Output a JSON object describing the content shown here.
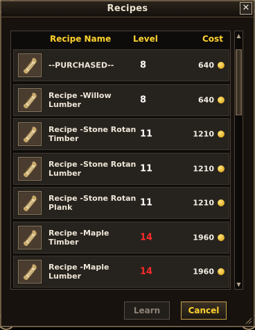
{
  "window": {
    "title": "Recipes",
    "close_glyph": "✕"
  },
  "header": {
    "name": "Recipe Name",
    "level": "Level",
    "cost": "Cost"
  },
  "colors": {
    "accent": "#ffd22e",
    "level_normal": "#ffffff",
    "level_high": "#ff2b2b"
  },
  "recipes": [
    {
      "name": "--PURCHASED--",
      "level": "8",
      "level_status": "normal",
      "cost": "640",
      "icon": "scroll-icon"
    },
    {
      "name": "Recipe -Willow Lumber",
      "level": "8",
      "level_status": "normal",
      "cost": "640",
      "icon": "scroll-icon"
    },
    {
      "name": "Recipe -Stone Rotan Timber",
      "level": "11",
      "level_status": "normal",
      "cost": "1210",
      "icon": "scroll-icon"
    },
    {
      "name": "Recipe -Stone Rotan Lumber",
      "level": "11",
      "level_status": "normal",
      "cost": "1210",
      "icon": "scroll-icon"
    },
    {
      "name": "Recipe -Stone Rotan Plank",
      "level": "11",
      "level_status": "normal",
      "cost": "1210",
      "icon": "scroll-icon"
    },
    {
      "name": "Recipe -Maple Timber",
      "level": "14",
      "level_status": "high",
      "cost": "1960",
      "icon": "scroll-icon"
    },
    {
      "name": "Recipe -Maple Lumber",
      "level": "14",
      "level_status": "high",
      "cost": "1960",
      "icon": "scroll-icon"
    }
  ],
  "buttons": {
    "learn": "Learn",
    "cancel": "Cancel",
    "learn_enabled": false
  }
}
